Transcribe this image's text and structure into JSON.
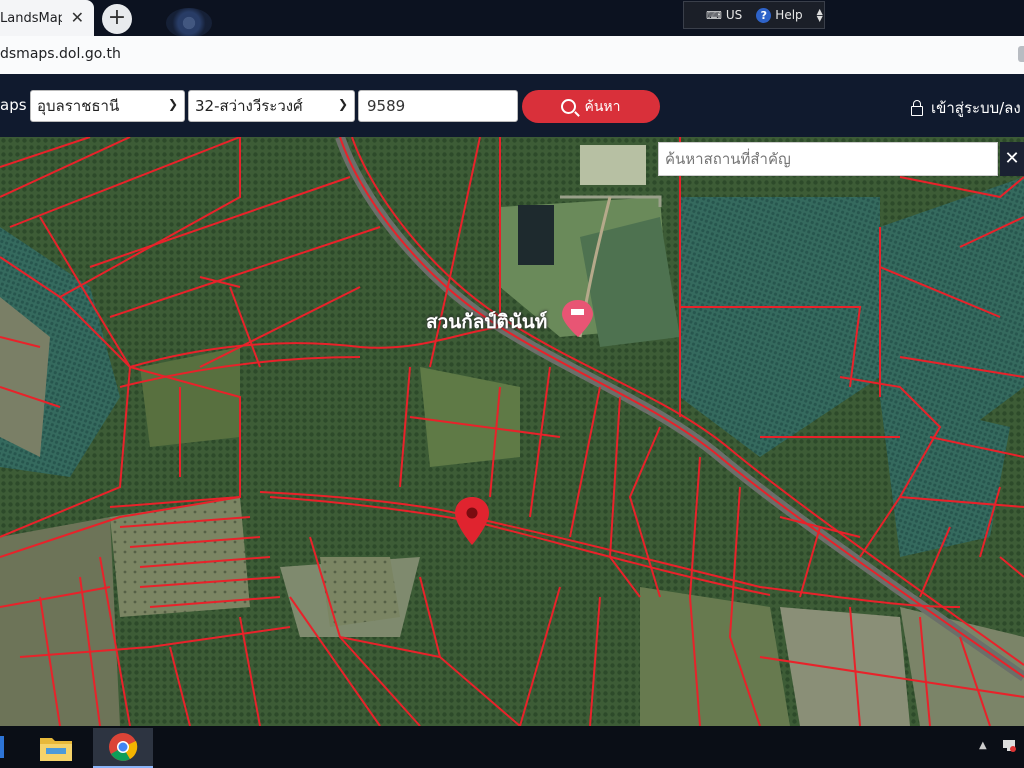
{
  "browser": {
    "tab_title": "LandsMaps",
    "tab_close": "✕",
    "new_tab": "+",
    "url": "dsmaps.dol.go.th"
  },
  "language_bar": {
    "lang": "US",
    "help": "Help"
  },
  "header": {
    "brand": "aps",
    "province": "อุบลราชธานี",
    "district": "32-สว่างวีระวงศ์",
    "parcel_number": "9589",
    "search_label": "ค้นหา",
    "login_label": "เข้าสู่ระบบ/ลง"
  },
  "map": {
    "place_search_placeholder": "ค้นหาสถานที่สำคัญ",
    "place_search_close": "✕",
    "poi_name": "สวนกัลป์ตินันท์",
    "colors": {
      "parcel_line": "#e8222a",
      "marker": "#e0242f",
      "poi_pin": "#e85574"
    }
  },
  "taskbar": {
    "tray_arrow": "▲"
  }
}
